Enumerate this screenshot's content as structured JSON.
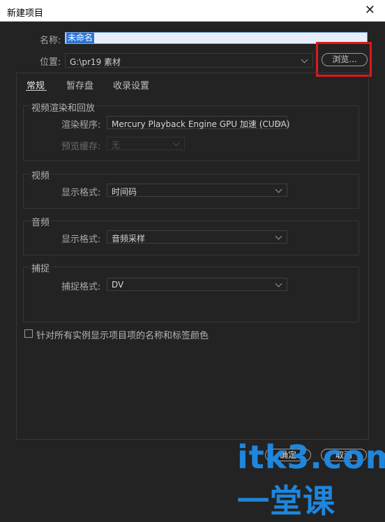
{
  "window": {
    "title": "新建项目",
    "close_glyph": "✕"
  },
  "name": {
    "label": "名称:",
    "value": "未命名"
  },
  "location": {
    "label": "位置:",
    "value": "G:\\pr19 素材",
    "browse_label": "浏览..."
  },
  "tabs": [
    {
      "label": "常规",
      "active": true
    },
    {
      "label": "暂存盘",
      "active": false
    },
    {
      "label": "收录设置",
      "active": false
    }
  ],
  "groups": {
    "video_rendering": {
      "title": "视频渲染和回放",
      "renderer_label": "渲染程序:",
      "renderer_value": "Mercury Playback Engine GPU 加速 (CUDA)",
      "preview_cache_label": "预览缓存:",
      "preview_cache_value": "无"
    },
    "video": {
      "title": "视频",
      "display_format_label": "显示格式:",
      "display_format_value": "时间码"
    },
    "audio": {
      "title": "音频",
      "display_format_label": "显示格式:",
      "display_format_value": "音频采样"
    },
    "capture": {
      "title": "捕捉",
      "capture_format_label": "捕捉格式:",
      "capture_format_value": "DV"
    }
  },
  "checkbox": {
    "label": "针对所有实例显示项目项的名称和标签颜色",
    "checked": false
  },
  "footer": {
    "ok_label": "确定",
    "cancel_label": "取消"
  },
  "watermark": "itk3.com一堂课",
  "colors": {
    "highlight": "#e0191a",
    "selection": "#2b74d8",
    "background": "#232323"
  }
}
